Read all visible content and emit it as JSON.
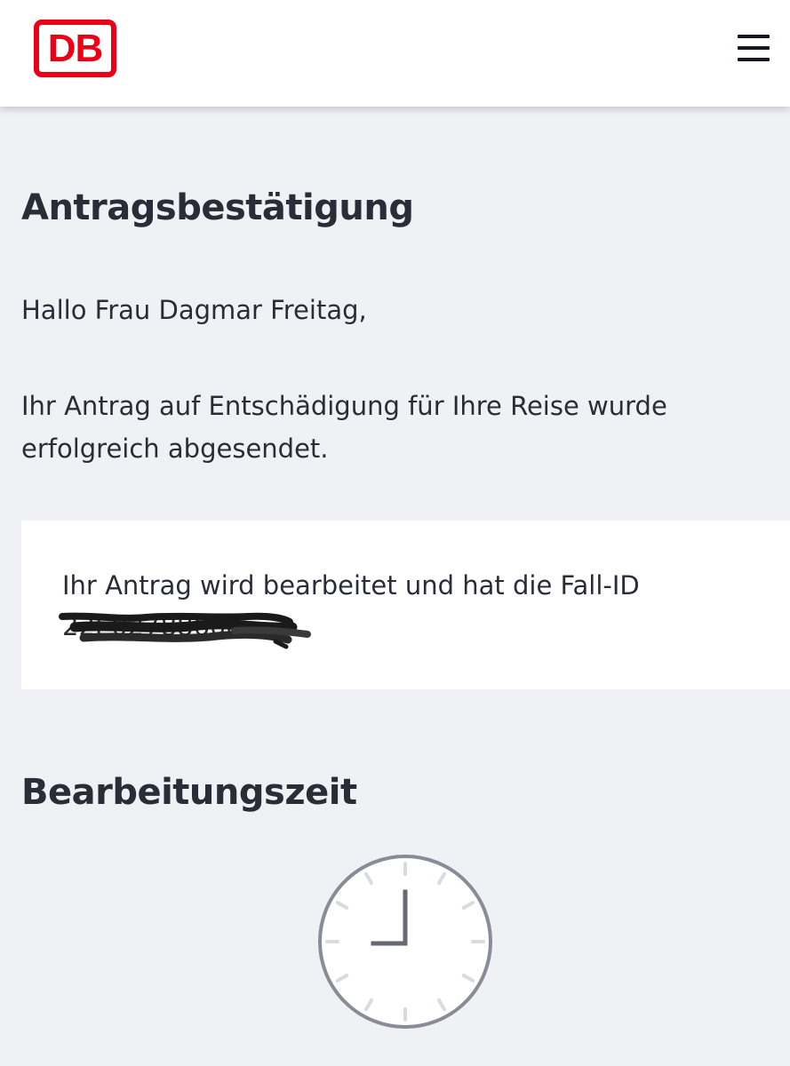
{
  "header": {
    "logo_text": "DB",
    "brand_color": "#ec0016",
    "menu_icon": "hamburger-menu-icon"
  },
  "content": {
    "title": "Antragsbestätigung",
    "greeting": "Hallo Frau Dagmar Freitag,",
    "message": "Ihr Antrag auf Entschädigung für Ihre Reise wurde erfolgreich abgesendet.",
    "case_text": "Ihr Antrag wird bearbeitet und hat die Fall-ID",
    "case_id": "22E02788608",
    "processing_title": "Bearbeitungszeit",
    "processing_icon": "clock-icon"
  },
  "colors": {
    "background": "#f0f1f4",
    "text": "#282d37",
    "card": "#ffffff"
  }
}
